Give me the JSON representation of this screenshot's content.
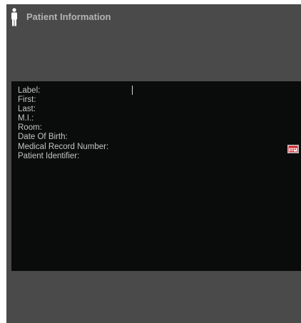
{
  "header": {
    "icon": "person-icon",
    "title": "Patient Information"
  },
  "form": {
    "fields": [
      {
        "label": "Label:",
        "value": ""
      },
      {
        "label": "First:",
        "value": ""
      },
      {
        "label": "Last:",
        "value": ""
      },
      {
        "label": "M.I.:",
        "value": ""
      },
      {
        "label": "Room:",
        "value": ""
      },
      {
        "label": "Date Of Birth:",
        "value": ""
      },
      {
        "label": "Medical Record Number:",
        "value": ""
      },
      {
        "label": "Patient Identifier:",
        "value": ""
      }
    ],
    "date_picker_icon": "calendar-icon"
  },
  "colors": {
    "window_background": "#4a4a4a",
    "panel_background": "#0a0c0c",
    "label_text": "#c4c4c4",
    "title_text": "#b4b4b4",
    "calendar_accent": "#d01c24"
  }
}
